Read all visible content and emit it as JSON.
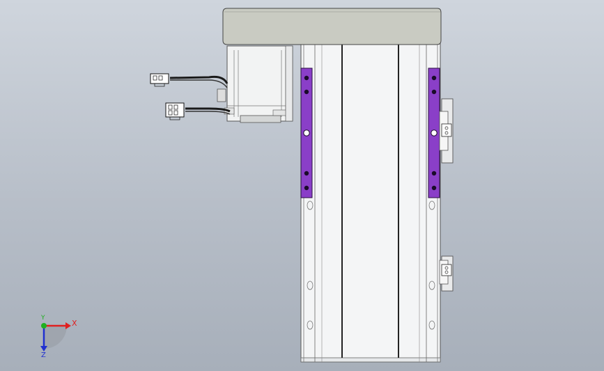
{
  "triad": {
    "x_label": "X",
    "y_label": "Y",
    "z_label": "Z"
  },
  "colors": {
    "background_top": "#cfd5dd",
    "background_bottom": "#a7afba",
    "motor_cover": "#c9cbc2",
    "rail_body": "#f4f5f6",
    "bracket": "#8a3fc8",
    "axis_x": "#e02020",
    "axis_y": "#20b020",
    "axis_z": "#2030d0"
  },
  "icons": [
    "motor-cover",
    "servo-motor",
    "cable-connector",
    "linear-rail",
    "mounting-bracket",
    "coordinate-triad-icon"
  ]
}
